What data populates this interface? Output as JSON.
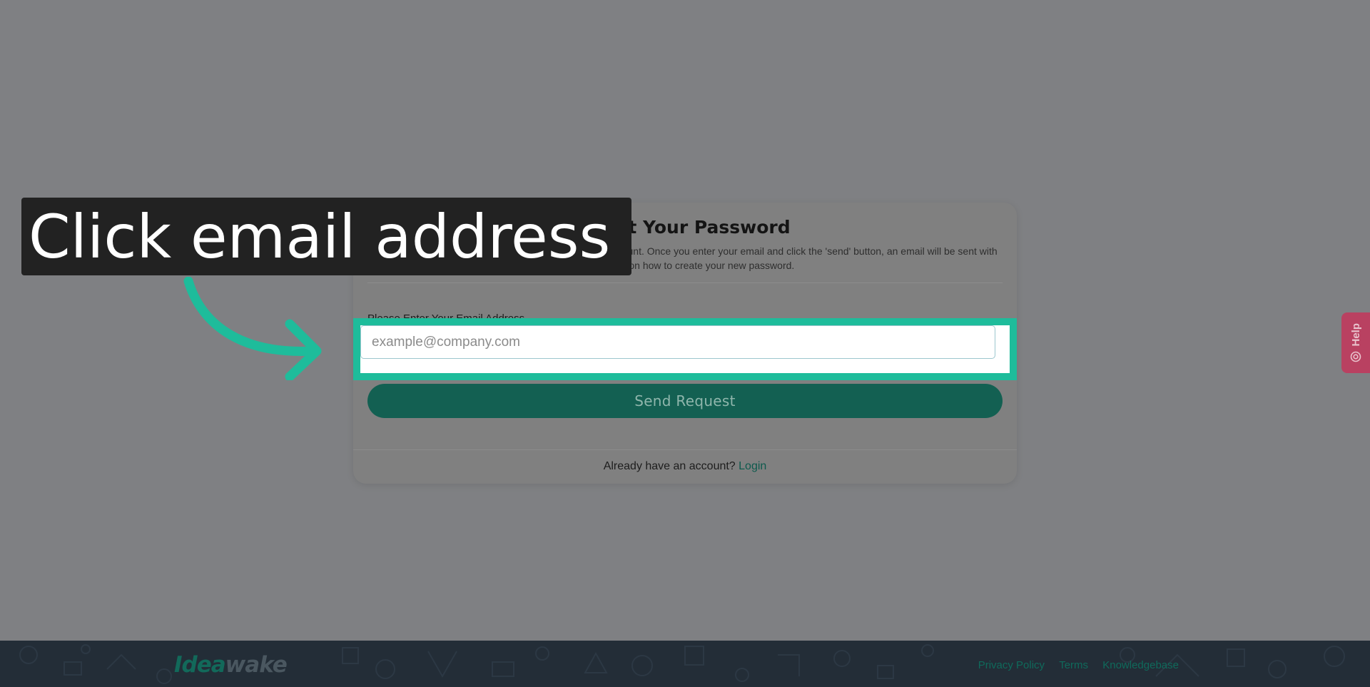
{
  "card": {
    "title": "Reset Your Password",
    "description_line1": "Please enter the email address associated with your account. Once you enter your email and click the 'send' button, an email will be sent with",
    "description_line2": "instructions on how to create your new password.",
    "email_label": "Please Enter Your Email Address",
    "email_placeholder": "example@company.com",
    "send_button": "Send Request",
    "login_prompt": "Already have an account?",
    "login_link": "Login"
  },
  "tooltip": {
    "text": "Click email address"
  },
  "help_tab": {
    "label": "Help",
    "icon": "lifebuoy-icon"
  },
  "footer": {
    "logo_part1": "Idea",
    "logo_part2": "wake",
    "links": [
      "Privacy Policy",
      "Terms",
      "Knowledgebase"
    ]
  },
  "colors": {
    "overlay_background": "#7f8083",
    "highlight": "#1ebc9b",
    "primary_button": "#136052",
    "footer": "#232d37",
    "help_tab": "#b94161"
  }
}
